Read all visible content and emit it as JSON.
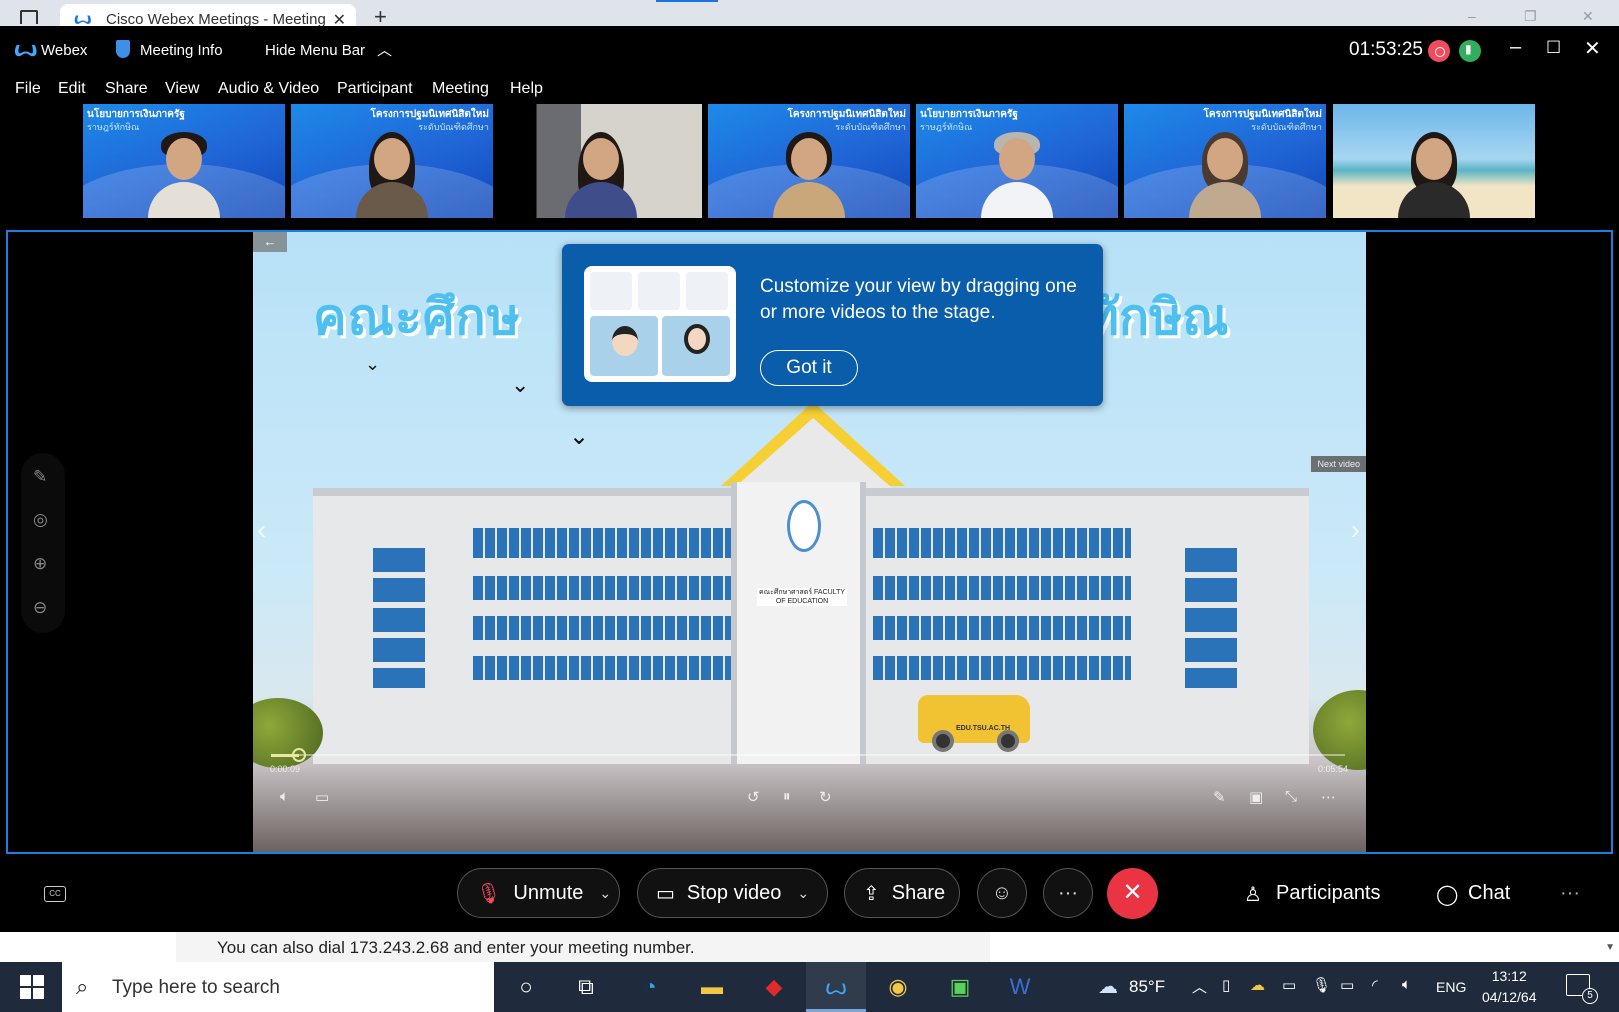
{
  "browser": {
    "tab_title": "Cisco Webex Meetings - Meeting",
    "tab_close_glyph": "✕",
    "new_tab_glyph": "+",
    "window_controls": [
      "–",
      "❐",
      "✕"
    ]
  },
  "titlebar": {
    "app_name": "Webex",
    "meeting_info": "Meeting Info",
    "hide_menu": "Hide Menu Bar",
    "timer": "01:53:25",
    "window_controls": [
      "–",
      "☐",
      "✕"
    ]
  },
  "menu": [
    "File",
    "Edit",
    "Share",
    "View",
    "Audio & Video",
    "Participant",
    "Meeting",
    "Help"
  ],
  "filmstrip": [
    {
      "banner": "นโยบายการเงินภาครัฐ",
      "sub": "ราษฎร์ทักษิณ",
      "bg": "blue"
    },
    {
      "banner": "โครงการปฐมนิเทศนิสิตใหม่",
      "sub": "ระดับบัณฑิตศึกษา",
      "bg": "blue"
    },
    {
      "banner": "",
      "sub": "",
      "bg": "room"
    },
    {
      "banner": "โครงการปฐมนิเทศนิสิตใหม่",
      "sub": "ระดับบัณฑิตศึกษา",
      "bg": "blue"
    },
    {
      "banner": "นโยบายการเงินภาครัฐ",
      "sub": "ราษฎร์ทักษิณ",
      "bg": "blue"
    },
    {
      "banner": "โครงการปฐมนิเทศนิสิตใหม่",
      "sub": "ระดับบัณฑิตศึกษา",
      "bg": "blue"
    },
    {
      "banner": "",
      "sub": "",
      "bg": "beach"
    }
  ],
  "video": {
    "heading_left": "คณะศึกษ",
    "heading_right": "ษทักษิณ",
    "faculty_sign": "คณะศึกษาศาสตร์ FACULTY OF EDUCATION",
    "bus_text": "EDU.TSU.AC.TH",
    "back_glyph": "←",
    "prev_glyph": "‹",
    "next_glyph": "›",
    "next_video": "Next video",
    "elapsed": "0:00:09",
    "duration": "0:05:54",
    "progress_fraction": 0.026
  },
  "coach": {
    "text": "Customize your view by dragging one or more videos to the stage.",
    "button": "Got it"
  },
  "controls": {
    "cc": "CC",
    "unmute": "Unmute",
    "stop_video": "Stop video",
    "share": "Share",
    "more": "···",
    "end": "✕",
    "participants": "Participants",
    "chat": "Chat",
    "overflow": "···"
  },
  "dial_text": "You can also dial 173.243.2.68 and enter your meeting number.",
  "taskbar": {
    "search_placeholder": "Type here to search",
    "temperature": "85°F",
    "language": "ENG",
    "time": "13:12",
    "date": "04/12/64",
    "notif_count": "5"
  },
  "colors": {
    "accent": "#1b7ee0",
    "coach_bg": "#0a5daa",
    "end_call": "#ea3343",
    "record": "#f24b5e",
    "network": "#2fae5b"
  }
}
